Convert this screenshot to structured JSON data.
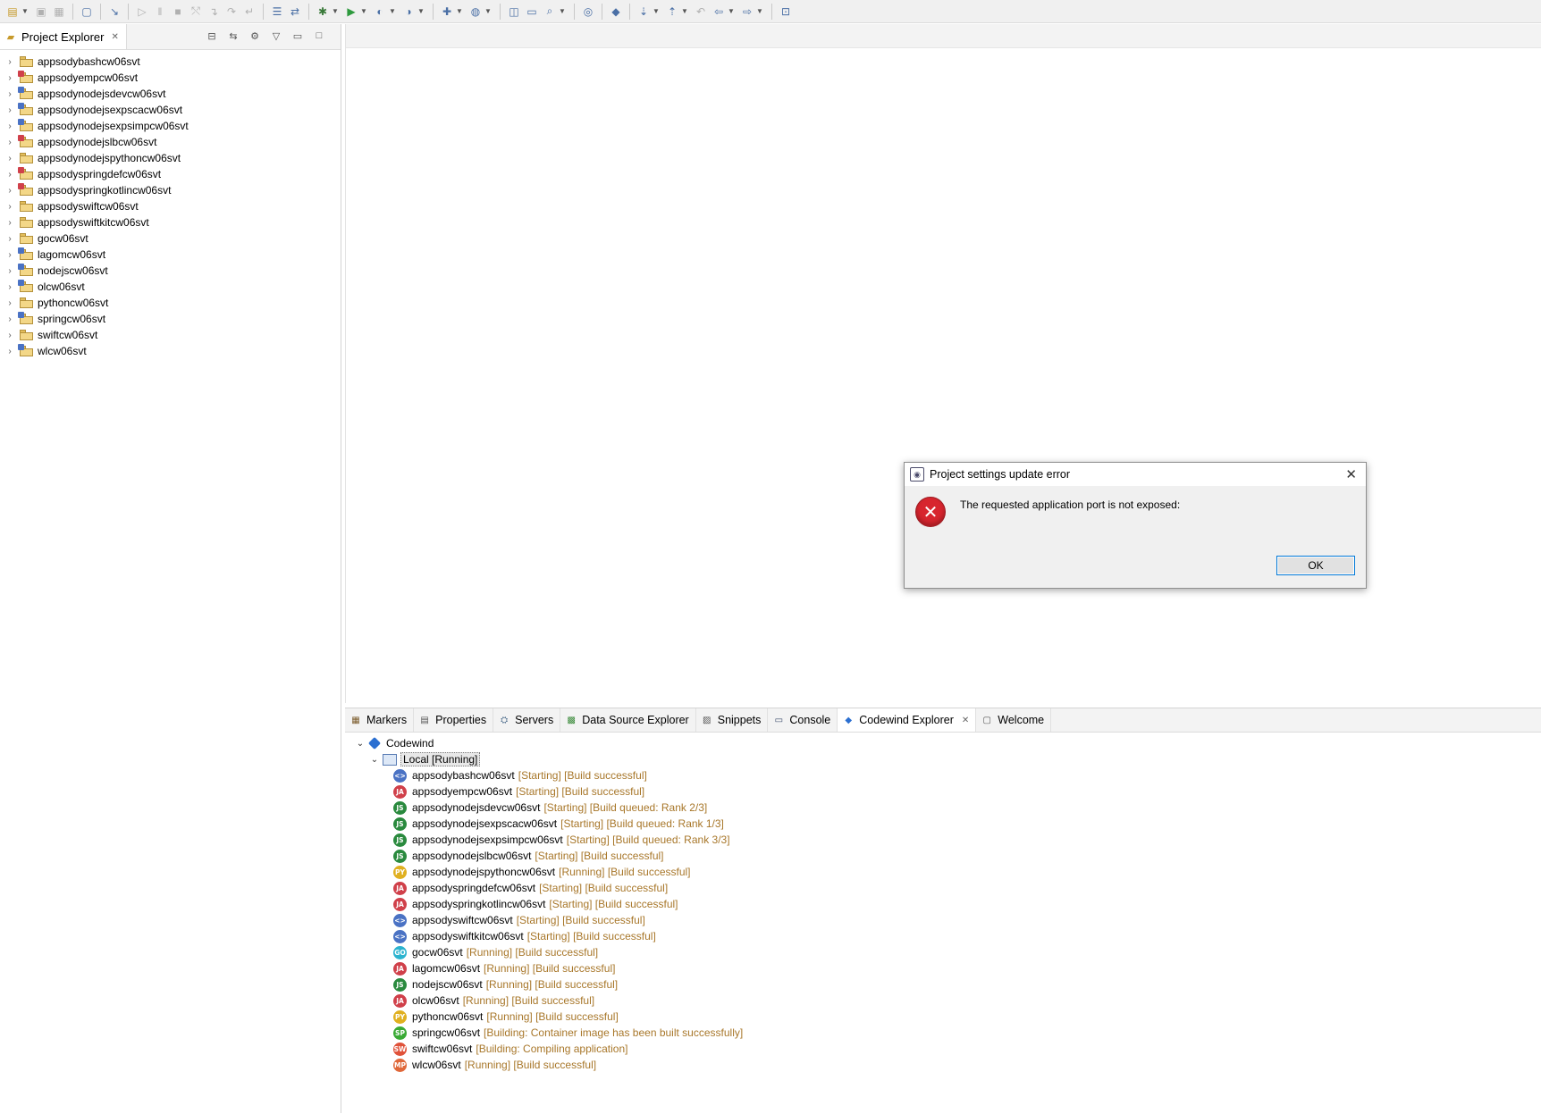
{
  "toolbar": {
    "icons": [
      "new-icon",
      "save-icon",
      "save-all-icon",
      "terminal-icon",
      "debug-skip-icon",
      "resume-icon",
      "suspend-icon",
      "terminate-icon",
      "disconnect-icon",
      "step-into-icon",
      "step-over-icon",
      "step-return-icon",
      "external-tools-icon",
      "toggle-mark-icon",
      "debug-icon",
      "run-icon",
      "coverage-icon",
      "profile-icon",
      "new-wizard-icon",
      "new-web-icon",
      "open-type-icon",
      "open-folder-icon",
      "search-icon",
      "globe-icon",
      "codewind-icon",
      "next-annotation-icon",
      "prev-annotation-icon",
      "last-edit-icon",
      "back-icon",
      "forward-icon",
      "pin-icon"
    ]
  },
  "project_explorer": {
    "title": "Project Explorer",
    "projects": [
      {
        "name": "appsodybashcw06svt",
        "overlay": "none"
      },
      {
        "name": "appsodyempcw06svt",
        "overlay": "red"
      },
      {
        "name": "appsodynodejsdevcw06svt",
        "overlay": "blue"
      },
      {
        "name": "appsodynodejsexpscacw06svt",
        "overlay": "blue"
      },
      {
        "name": "appsodynodejsexpsimpcw06svt",
        "overlay": "blue"
      },
      {
        "name": "appsodynodejslbcw06svt",
        "overlay": "red"
      },
      {
        "name": "appsodynodejspythoncw06svt",
        "overlay": "none"
      },
      {
        "name": "appsodyspringdefcw06svt",
        "overlay": "red"
      },
      {
        "name": "appsodyspringkotlincw06svt",
        "overlay": "red"
      },
      {
        "name": "appsodyswiftcw06svt",
        "overlay": "none"
      },
      {
        "name": "appsodyswiftkitcw06svt",
        "overlay": "none"
      },
      {
        "name": "gocw06svt",
        "overlay": "none"
      },
      {
        "name": "lagomcw06svt",
        "overlay": "blue"
      },
      {
        "name": "nodejscw06svt",
        "overlay": "blue"
      },
      {
        "name": "olcw06svt",
        "overlay": "blue"
      },
      {
        "name": "pythoncw06svt",
        "overlay": "none"
      },
      {
        "name": "springcw06svt",
        "overlay": "blue"
      },
      {
        "name": "swiftcw06svt",
        "overlay": "none"
      },
      {
        "name": "wlcw06svt",
        "overlay": "blue"
      }
    ]
  },
  "bottom_tabs": [
    {
      "label": "Markers",
      "icon": "markers-icon",
      "active": false
    },
    {
      "label": "Properties",
      "icon": "properties-icon",
      "active": false
    },
    {
      "label": "Servers",
      "icon": "servers-icon",
      "active": false
    },
    {
      "label": "Data Source Explorer",
      "icon": "data-source-icon",
      "active": false
    },
    {
      "label": "Snippets",
      "icon": "snippets-icon",
      "active": false
    },
    {
      "label": "Console",
      "icon": "console-icon",
      "active": false
    },
    {
      "label": "Codewind Explorer",
      "icon": "codewind-icon",
      "active": true
    },
    {
      "label": "Welcome",
      "icon": "welcome-icon",
      "active": false
    }
  ],
  "codewind": {
    "root": "Codewind",
    "local": "Local [Running]",
    "projects": [
      {
        "name": "appsodybashcw06svt",
        "status": "[Starting] [Build successful]",
        "badge": "<>",
        "color": "#4a72c4"
      },
      {
        "name": "appsodyempcw06svt",
        "status": "[Starting] [Build successful]",
        "badge": "JA",
        "color": "#d0404a"
      },
      {
        "name": "appsodynodejsdevcw06svt",
        "status": "[Starting] [Build queued: Rank 2/3]",
        "badge": "JS",
        "color": "#2a8a3e"
      },
      {
        "name": "appsodynodejsexpscacw06svt",
        "status": "[Starting] [Build queued: Rank 1/3]",
        "badge": "JS",
        "color": "#2a8a3e"
      },
      {
        "name": "appsodynodejsexpsimpcw06svt",
        "status": "[Starting] [Build queued: Rank 3/3]",
        "badge": "JS",
        "color": "#2a8a3e"
      },
      {
        "name": "appsodynodejslbcw06svt",
        "status": "[Starting] [Build successful]",
        "badge": "JS",
        "color": "#2a8a3e"
      },
      {
        "name": "appsodynodejspythoncw06svt",
        "status": "[Running] [Build successful]",
        "badge": "PY",
        "color": "#e0b020"
      },
      {
        "name": "appsodyspringdefcw06svt",
        "status": "[Starting] [Build successful]",
        "badge": "JA",
        "color": "#d0404a"
      },
      {
        "name": "appsodyspringkotlincw06svt",
        "status": "[Starting] [Build successful]",
        "badge": "JA",
        "color": "#d0404a"
      },
      {
        "name": "appsodyswiftcw06svt",
        "status": "[Starting] [Build successful]",
        "badge": "<>",
        "color": "#4a72c4"
      },
      {
        "name": "appsodyswiftkitcw06svt",
        "status": "[Starting] [Build successful]",
        "badge": "<>",
        "color": "#4a72c4"
      },
      {
        "name": "gocw06svt",
        "status": "[Running] [Build successful]",
        "badge": "GO",
        "color": "#2bb3cf"
      },
      {
        "name": "lagomcw06svt",
        "status": "[Running] [Build successful]",
        "badge": "JA",
        "color": "#d0404a"
      },
      {
        "name": "nodejscw06svt",
        "status": "[Running] [Build successful]",
        "badge": "JS",
        "color": "#2a8a3e"
      },
      {
        "name": "olcw06svt",
        "status": "[Running] [Build successful]",
        "badge": "JA",
        "color": "#d0404a"
      },
      {
        "name": "pythoncw06svt",
        "status": "[Running] [Build successful]",
        "badge": "PY",
        "color": "#e0b020"
      },
      {
        "name": "springcw06svt",
        "status": "[Building: Container image has been built successfully]",
        "badge": "SP",
        "color": "#3aaa35"
      },
      {
        "name": "swiftcw06svt",
        "status": "[Building: Compiling application]",
        "badge": "SW",
        "color": "#e0523a"
      },
      {
        "name": "wlcw06svt",
        "status": "[Running] [Build successful]",
        "badge": "MP",
        "color": "#e0683a"
      }
    ]
  },
  "dialog": {
    "title": "Project settings update error",
    "message": "The requested application port is not exposed:",
    "ok_label": "OK"
  },
  "colors": {
    "status_text": "#a8772a",
    "error_red": "#d7252e",
    "focus_blue": "#0078d7"
  }
}
